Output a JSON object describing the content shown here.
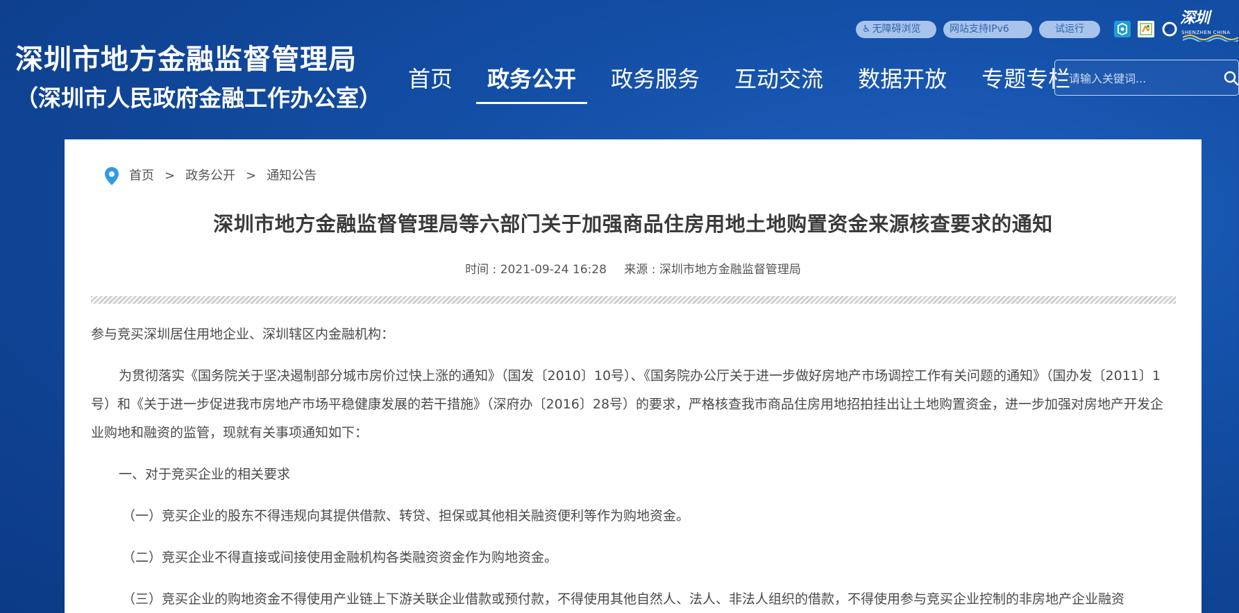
{
  "header": {
    "title_line1": "深圳市地方金融监督管理局",
    "title_line2": "（深圳市人民政府金融工作办公室）",
    "tools": {
      "accessible": "无障碍浏览",
      "ipv6": "网站支持IPv6",
      "trial": "试运行"
    },
    "icons": [
      "accessibility-icon",
      "wechat-mini-icon",
      "mini-program-icon",
      "weibo-icon",
      "shenzhen-logo"
    ],
    "logo_text": "深圳",
    "logo_sub": "SHENZHEN CHINA"
  },
  "nav": {
    "items": [
      "首页",
      "政务公开",
      "政务服务",
      "互动交流",
      "数据开放",
      "专题专栏"
    ],
    "active_index": 1
  },
  "search": {
    "placeholder": "请输入关键词..."
  },
  "breadcrumb": {
    "items": [
      "首页",
      "政务公开",
      "通知公告"
    ],
    "separator": ">"
  },
  "article": {
    "title": "深圳市地方金融监督管理局等六部门关于加强商品住房用地土地购置资金来源核查要求的通知",
    "time": "时间 : 2021-09-24 16:28",
    "source": "来源 : 深圳市地方金融监督管理局",
    "salutation": "参与竞买深圳居住用地企业、深圳辖区内金融机构：",
    "intro": "为贯彻落实《国务院关于坚决遏制部分城市房价过快上涨的通知》（国发〔2010〕10号）、《国务院办公厅关于进一步做好房地产市场调控工作有关问题的通知》（国办发〔2011〕1号）和《关于进一步促进我市房地产市场平稳健康发展的若干措施》（深府办〔2016〕28号）的要求，严格核查我市商品住房用地招拍挂出让土地购置资金，进一步加强对房地产开发企业购地和融资的监管，现就有关事项通知如下：",
    "section1": "一、对于竞买企业的相关要求",
    "item1": "（一）竞买企业的股东不得违规向其提供借款、转贷、担保或其他相关融资便利等作为购地资金。",
    "item2": "（二）竞买企业不得直接或间接使用金融机构各类融资资金作为购地资金。",
    "item3": "（三）竞买企业的购地资金不得使用产业链上下游关联企业借款或预付款，不得使用其他自然人、法人、非法人组织的借款，不得使用参与竞买企业控制的非房地产企业融资"
  },
  "colors": {
    "header_bg": "#1450a8",
    "pill_bg": "#a9c4ec",
    "text_dark": "#3a3a3a"
  }
}
